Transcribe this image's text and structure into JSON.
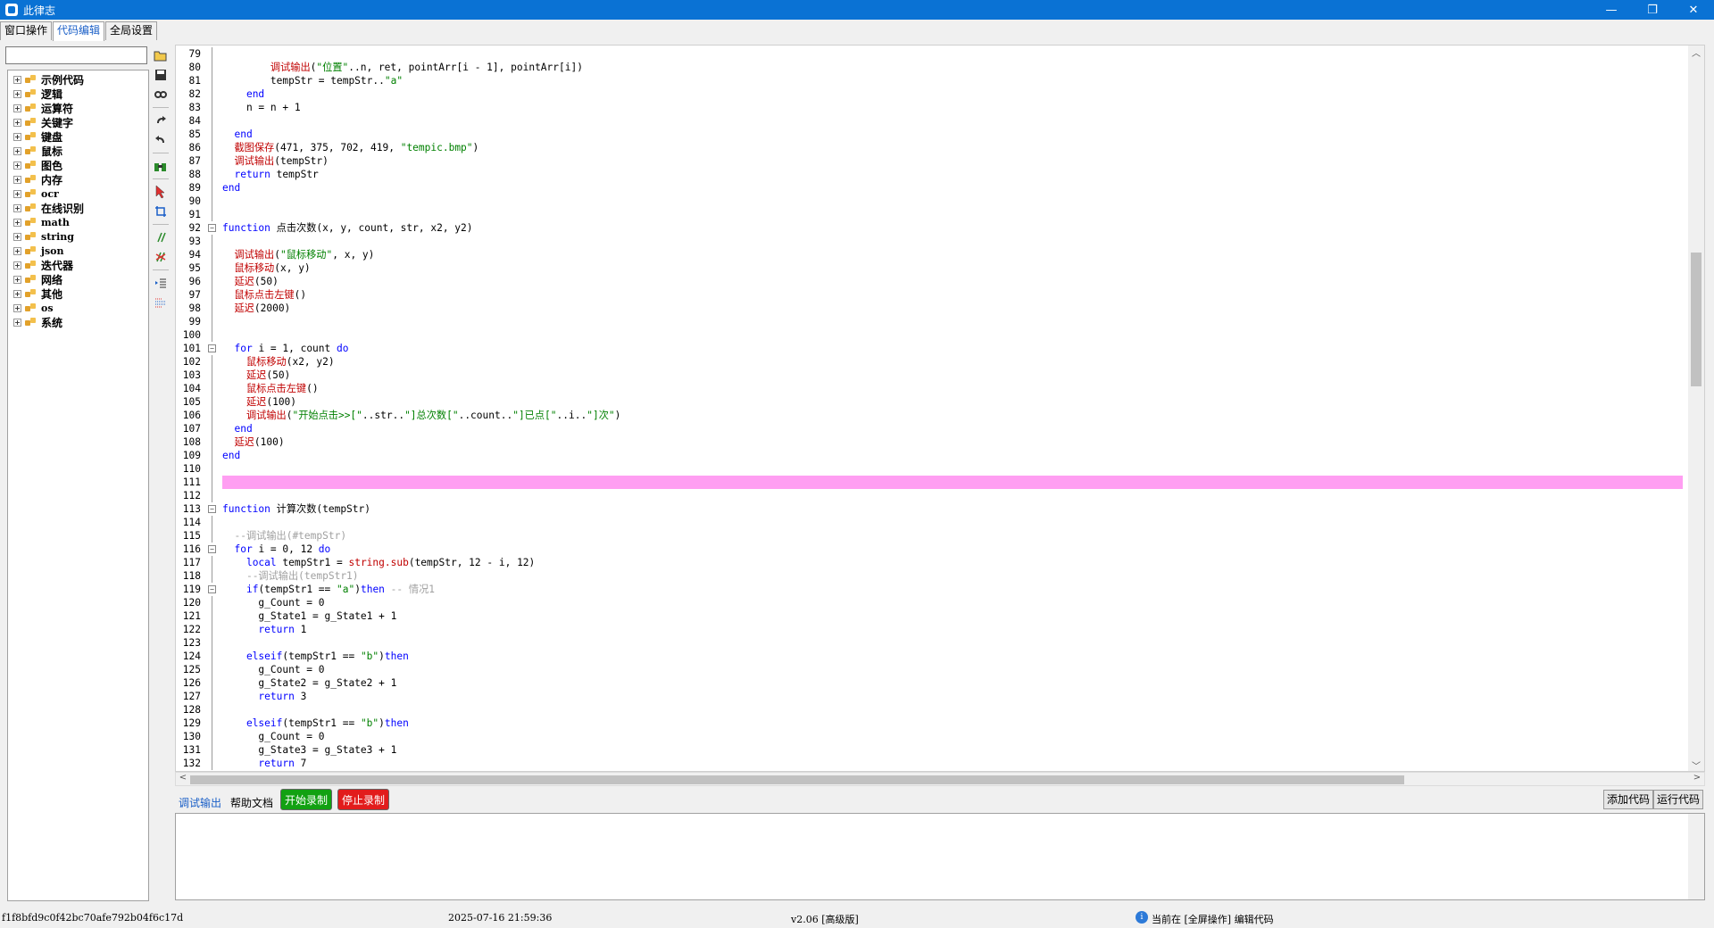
{
  "window": {
    "title": "此律志",
    "minimize": "—",
    "restore": "❐",
    "close": "✕"
  },
  "tabs": [
    "窗口操作",
    "代码编辑",
    "全局设置"
  ],
  "tree": [
    {
      "label": "示例代码",
      "mono": false
    },
    {
      "label": "逻辑",
      "mono": false
    },
    {
      "label": "运算符",
      "mono": false
    },
    {
      "label": "关键字",
      "mono": false
    },
    {
      "label": "键盘",
      "mono": false
    },
    {
      "label": "鼠标",
      "mono": false
    },
    {
      "label": "图色",
      "mono": false
    },
    {
      "label": "内存",
      "mono": false
    },
    {
      "label": "ocr",
      "mono": true
    },
    {
      "label": "在线识别",
      "mono": false
    },
    {
      "label": "math",
      "mono": true
    },
    {
      "label": "string",
      "mono": true
    },
    {
      "label": "json",
      "mono": true
    },
    {
      "label": "迭代器",
      "mono": false
    },
    {
      "label": "网络",
      "mono": false
    },
    {
      "label": "其他",
      "mono": false
    },
    {
      "label": "os",
      "mono": true
    },
    {
      "label": "系统",
      "mono": false
    }
  ],
  "toolbar_icons": [
    "open-icon",
    "save-icon",
    "link-icon",
    "redo-icon",
    "undo-icon",
    "find-icon",
    "pointer-icon",
    "crop-icon",
    "comment-icon",
    "uncomment-icon",
    "indent-icon",
    "outdent-icon"
  ],
  "code_lines": [
    {
      "n": "79",
      "h": ""
    },
    {
      "n": "80",
      "h": "        <span class='fn'>调试输出</span>(<span class='str'>\"位置\"</span>..n, ret, pointArr[i - 1], pointArr[i])"
    },
    {
      "n": "81",
      "h": "        tempStr = tempStr..<span class='str'>\"a\"</span>"
    },
    {
      "n": "82",
      "h": "    <span class='kw'>end</span>"
    },
    {
      "n": "83",
      "h": "    n = n + 1"
    },
    {
      "n": "84",
      "h": ""
    },
    {
      "n": "85",
      "h": "  <span class='kw'>end</span>"
    },
    {
      "n": "86",
      "h": "  <span class='fn'>截图保存</span>(471, 375, 702, 419, <span class='str'>\"tempic.bmp\"</span>)"
    },
    {
      "n": "87",
      "h": "  <span class='fn'>调试输出</span>(tempStr)"
    },
    {
      "n": "88",
      "h": "  <span class='kw'>return</span> tempStr"
    },
    {
      "n": "89",
      "h": "<span class='kw'>end</span>"
    },
    {
      "n": "90",
      "h": ""
    },
    {
      "n": "91",
      "h": ""
    },
    {
      "n": "92",
      "h": "<span class='kw'>function</span> 点击次数(x, y, count, str, x2, y2)",
      "fold": true
    },
    {
      "n": "93",
      "h": ""
    },
    {
      "n": "94",
      "h": "  <span class='fn'>调试输出</span>(<span class='str'>\"鼠标移动\"</span>, x, y)"
    },
    {
      "n": "95",
      "h": "  <span class='fn'>鼠标移动</span>(x, y)"
    },
    {
      "n": "96",
      "h": "  <span class='fn'>延迟</span>(50)"
    },
    {
      "n": "97",
      "h": "  <span class='fn'>鼠标点击左键</span>()"
    },
    {
      "n": "98",
      "h": "  <span class='fn'>延迟</span>(2000)"
    },
    {
      "n": "99",
      "h": ""
    },
    {
      "n": "100",
      "h": ""
    },
    {
      "n": "101",
      "h": "  <span class='kw'>for</span> i = 1, count <span class='kw'>do</span>",
      "fold": true
    },
    {
      "n": "102",
      "h": "    <span class='fn'>鼠标移动</span>(x2, y2)"
    },
    {
      "n": "103",
      "h": "    <span class='fn'>延迟</span>(50)"
    },
    {
      "n": "104",
      "h": "    <span class='fn'>鼠标点击左键</span>()"
    },
    {
      "n": "105",
      "h": "    <span class='fn'>延迟</span>(100)"
    },
    {
      "n": "106",
      "h": "    <span class='fn'>调试输出</span>(<span class='str'>\"开始点击>>[\"</span>..str..<span class='str'>\"]总次数[\"</span>..count..<span class='str'>\"]已点[\"</span>..i..<span class='str'>\"]次\"</span>)"
    },
    {
      "n": "107",
      "h": "  <span class='kw'>end</span>"
    },
    {
      "n": "108",
      "h": "  <span class='fn'>延迟</span>(100)"
    },
    {
      "n": "109",
      "h": "<span class='kw'>end</span>"
    },
    {
      "n": "110",
      "h": ""
    },
    {
      "n": "111",
      "h": "",
      "hl": true
    },
    {
      "n": "112",
      "h": ""
    },
    {
      "n": "113",
      "h": "<span class='kw'>function</span> 计算次数(tempStr)",
      "fold": true
    },
    {
      "n": "114",
      "h": ""
    },
    {
      "n": "115",
      "h": "  <span class='cm'>--调试输出(#tempStr)</span>"
    },
    {
      "n": "116",
      "h": "  <span class='kw'>for</span> i = 0, 12 <span class='kw'>do</span>",
      "fold": true
    },
    {
      "n": "117",
      "h": "    <span class='kw'>local</span> tempStr1 = <span class='fn'>string.sub</span>(tempStr, 12 - i, 12)"
    },
    {
      "n": "118",
      "h": "    <span class='cm'>--调试输出(tempStr1)</span>"
    },
    {
      "n": "119",
      "h": "    <span class='kw'>if</span>(tempStr1 == <span class='str'>\"a\"</span>)<span class='kw'>then</span> <span class='cm'>-- 情况1</span>",
      "fold": true
    },
    {
      "n": "120",
      "h": "      g_Count = 0"
    },
    {
      "n": "121",
      "h": "      g_State1 = g_State1 + 1"
    },
    {
      "n": "122",
      "h": "      <span class='kw'>return</span> 1"
    },
    {
      "n": "123",
      "h": ""
    },
    {
      "n": "124",
      "h": "    <span class='kw'>elseif</span>(tempStr1 == <span class='str'>\"b\"</span>)<span class='kw'>then</span>"
    },
    {
      "n": "125",
      "h": "      g_Count = 0"
    },
    {
      "n": "126",
      "h": "      g_State2 = g_State2 + 1"
    },
    {
      "n": "127",
      "h": "      <span class='kw'>return</span> 3"
    },
    {
      "n": "128",
      "h": ""
    },
    {
      "n": "129",
      "h": "    <span class='kw'>elseif</span>(tempStr1 == <span class='str'>\"b\"</span>)<span class='kw'>then</span>"
    },
    {
      "n": "130",
      "h": "      g_Count = 0"
    },
    {
      "n": "131",
      "h": "      g_State3 = g_State3 + 1"
    },
    {
      "n": "132",
      "h": "      <span class='kw'>return</span> 7"
    }
  ],
  "bottom": {
    "debug_tab": "调试输出",
    "help_tab": "帮助文档",
    "start_record": "开始录制",
    "stop_record": "停止录制",
    "add_code": "添加代码",
    "run_code": "运行代码"
  },
  "status": {
    "hash": "f1f8bfd9c0f42bc70afe792b04f6c17d",
    "datetime": "2025-07-16 21:59:36",
    "version": "v2.06 [高级版]",
    "mode": "当前在 [全屏操作] 编辑代码"
  }
}
